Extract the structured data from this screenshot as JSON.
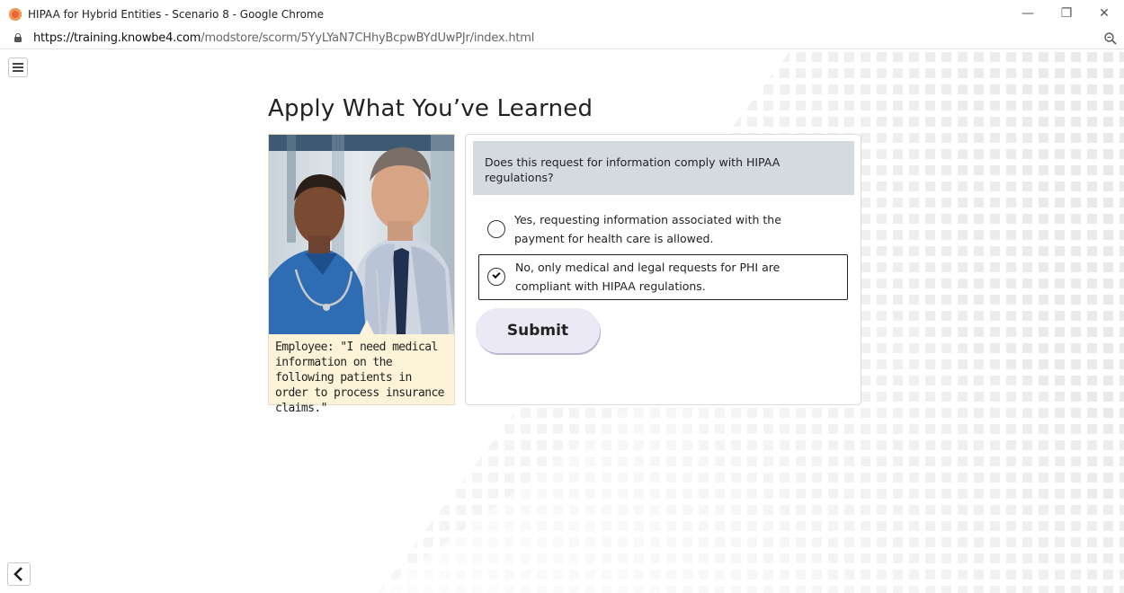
{
  "browser": {
    "window_title": "HIPAA for Hybrid Entities - Scenario 8 - Google Chrome",
    "url_host": "https://training.knowbe4.com",
    "url_path": "/modstore/scorm/5YyLYaN7CHhyBcpwBYdUwPJr/index.html",
    "controls": {
      "minimize": "—",
      "restore": "❐",
      "close": "✕"
    }
  },
  "page": {
    "heading": "Apply What You’ve Learned",
    "scenario_caption": "Employee: \"I need medical information on the following patients in order to process insurance claims.\"",
    "question": "Does this request for information comply with HIPAA regulations?",
    "options": [
      {
        "label": "Yes, requesting information associated with the payment for health care is allowed.",
        "selected": false
      },
      {
        "label": "No, only medical and legal requests for PHI are compliant with HIPAA regulations.",
        "selected": true
      }
    ],
    "submit_label": "Submit"
  },
  "icons": {
    "menu": "hamburger-menu-icon",
    "back": "chevron-left-icon",
    "lock": "lock-icon",
    "zoom": "zoom-icon",
    "browser_logo": "chrome-logo-icon"
  },
  "colors": {
    "question_bg": "#d5dae1",
    "caption_bg": "#fdf3d9",
    "submit_bg": "#ebe9f6",
    "selected_border": "#222222"
  }
}
